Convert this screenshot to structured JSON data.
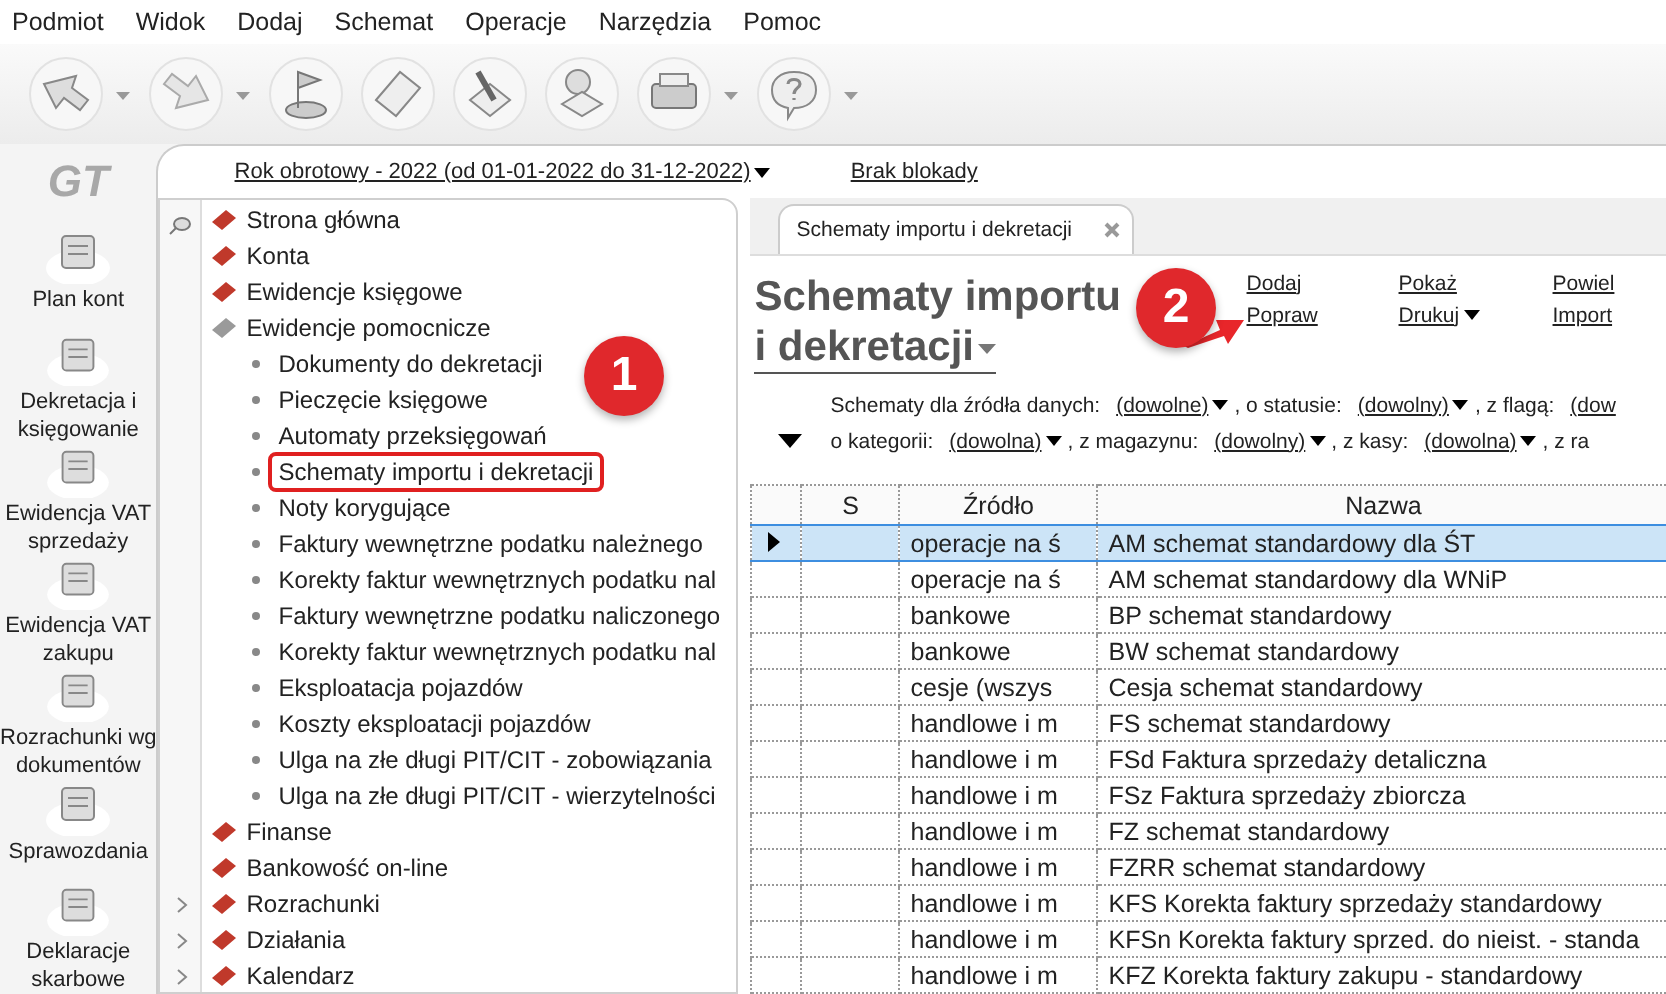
{
  "menu": [
    "Podmiot",
    "Widok",
    "Dodaj",
    "Schemat",
    "Operacje",
    "Narzędzia",
    "Pomoc"
  ],
  "toolbar": [
    {
      "kind": "back",
      "dropdown": true
    },
    {
      "kind": "forward",
      "dropdown": true
    },
    {
      "kind": "flag",
      "dropdown": false
    },
    {
      "kind": "note",
      "dropdown": false
    },
    {
      "kind": "pen",
      "dropdown": false
    },
    {
      "kind": "stamp",
      "dropdown": false
    },
    {
      "kind": "printer",
      "dropdown": true
    },
    {
      "kind": "help",
      "dropdown": true
    }
  ],
  "logo": "GT",
  "period": {
    "label": "Rok obrotowy - 2022  (od 01-01-2022 do 31-12-2022)",
    "lock": "Brak blokady"
  },
  "left_bar": [
    {
      "lines": [
        "Plan kont"
      ]
    },
    {
      "lines": [
        "Dekretacja i",
        "księgowanie"
      ]
    },
    {
      "lines": [
        "Ewidencja VAT",
        "sprzedaży"
      ]
    },
    {
      "lines": [
        "Ewidencja VAT",
        "zakupu"
      ]
    },
    {
      "lines": [
        "Rozrachunki wg",
        "dokumentów"
      ]
    },
    {
      "lines": [
        "Sprawozdania"
      ]
    },
    {
      "lines": [
        "Deklaracje",
        "skarbowe"
      ]
    }
  ],
  "tree": [
    {
      "label": "Strona główna",
      "color": "#c0392b",
      "expandable": false
    },
    {
      "label": "Konta",
      "color": "#c0392b",
      "expandable": false
    },
    {
      "label": "Ewidencje księgowe",
      "color": "#c0392b",
      "expandable": false
    },
    {
      "label": "Ewidencje pomocnicze",
      "color": "#9a9a9a",
      "expandable": false,
      "children": [
        {
          "label": "Dokumenty do dekretacji",
          "highlighted": false
        },
        {
          "label": "Pieczęcie księgowe",
          "highlighted": false
        },
        {
          "label": "Automaty przeksięgowań",
          "highlighted": false
        },
        {
          "label": "Schematy importu i dekretacji",
          "highlighted": true
        },
        {
          "label": "Noty korygujące",
          "highlighted": false
        },
        {
          "label": "Faktury wewnętrzne podatku należnego",
          "highlighted": false
        },
        {
          "label": "Korekty faktur wewnętrznych podatku nal",
          "highlighted": false
        },
        {
          "label": "Faktury wewnętrzne podatku naliczonego",
          "highlighted": false
        },
        {
          "label": "Korekty faktur wewnętrznych podatku nal",
          "highlighted": false
        },
        {
          "label": "Eksploatacja pojazdów",
          "highlighted": false
        },
        {
          "label": "Koszty eksploatacji pojazdów",
          "highlighted": false
        },
        {
          "label": "Ulga na złe długi PIT/CIT - zobowiązania",
          "highlighted": false
        },
        {
          "label": "Ulga na złe długi PIT/CIT - wierzytelności",
          "highlighted": false
        }
      ]
    },
    {
      "label": "Finanse",
      "color": "#c0392b",
      "expandable": false
    },
    {
      "label": "Bankowość on-line",
      "color": "#c0392b",
      "expandable": false
    },
    {
      "label": "Rozrachunki",
      "color": "#c0392b",
      "expandable": true
    },
    {
      "label": "Działania",
      "color": "#c0392b",
      "expandable": true
    },
    {
      "label": "Kalendarz",
      "color": "#c0392b",
      "expandable": true
    }
  ],
  "tab": {
    "label": "Schematy importu i dekretacji",
    "closable": true
  },
  "title": {
    "lines": [
      "Schematy importu",
      "i dekretacji"
    ]
  },
  "actions": [
    {
      "label": "Dodaj",
      "dropdown": false
    },
    {
      "label": "Popraw",
      "dropdown": false
    },
    {
      "label": "Pokaż",
      "dropdown": false
    },
    {
      "label": "Drukuj",
      "dropdown": true
    },
    {
      "label": "Powiel",
      "dropdown": false
    },
    {
      "label": "Import",
      "dropdown": false
    }
  ],
  "filters": [
    [
      {
        "label": "Schematy dla źródła danych:",
        "value": "(dowolne)",
        "dropdown": true
      },
      {
        "label": ", o statusie:",
        "value": "(dowolny)",
        "dropdown": true
      },
      {
        "label": ", z flagą:",
        "value": "(dow",
        "dropdown": false
      }
    ],
    [
      {
        "label": "o kategorii:",
        "value": "(dowolna)",
        "dropdown": true
      },
      {
        "label": ", z magazynu:",
        "value": "(dowolny)",
        "dropdown": true
      },
      {
        "label": ", z kasy:",
        "value": "(dowolna)",
        "dropdown": true
      },
      {
        "label": ", z ra"
      }
    ]
  ],
  "table": {
    "columns": [
      "S",
      "Źródło",
      "Nazwa"
    ],
    "rows": [
      {
        "cells": [
          "",
          "operacje na ś",
          "AM schemat standardowy dla ŚT"
        ],
        "selected": true
      },
      {
        "cells": [
          "",
          "operacje na ś",
          "AM schemat standardowy dla WNiP"
        ],
        "selected": false
      },
      {
        "cells": [
          "",
          "bankowe",
          "BP schemat standardowy"
        ],
        "selected": false
      },
      {
        "cells": [
          "",
          "bankowe",
          "BW schemat standardowy"
        ],
        "selected": false
      },
      {
        "cells": [
          "",
          "cesje (wszys",
          "Cesja schemat standardowy"
        ],
        "selected": false
      },
      {
        "cells": [
          "",
          "handlowe i m",
          "FS schemat standardowy"
        ],
        "selected": false
      },
      {
        "cells": [
          "",
          "handlowe i m",
          "FSd Faktura sprzedaży detaliczna"
        ],
        "selected": false
      },
      {
        "cells": [
          "",
          "handlowe i m",
          "FSz Faktura sprzedaży zbiorcza"
        ],
        "selected": false
      },
      {
        "cells": [
          "",
          "handlowe i m",
          "FZ schemat standardowy"
        ],
        "selected": false
      },
      {
        "cells": [
          "",
          "handlowe i m",
          "FZRR schemat standardowy"
        ],
        "selected": false
      },
      {
        "cells": [
          "",
          "handlowe i m",
          "KFS Korekta faktury sprzedaży standardowy"
        ],
        "selected": false
      },
      {
        "cells": [
          "",
          "handlowe i m",
          "KFSn Korekta faktury sprzed. do nieist. - standa"
        ],
        "selected": false
      },
      {
        "cells": [
          "",
          "handlowe i m",
          "KFZ Korekta faktury zakupu - standardowy"
        ],
        "selected": false
      }
    ]
  },
  "callouts": [
    {
      "number": "1",
      "arrow": false
    },
    {
      "number": "2",
      "arrow": true
    }
  ]
}
